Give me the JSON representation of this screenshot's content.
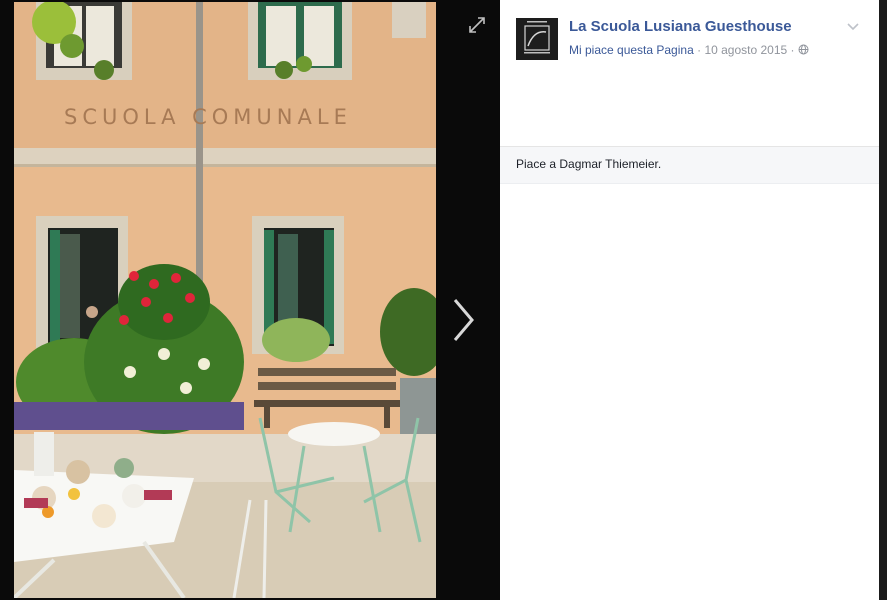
{
  "photo": {
    "sign_text": "SCUOLA COMUNALE",
    "expand_icon": "expand-icon",
    "next_icon": "chevron-right-icon"
  },
  "post": {
    "page_name": "La Scuola Lusiana Guesthouse",
    "like_page": "Mi piace questa Pagina",
    "date": "10 agosto 2015",
    "separator": "·",
    "privacy_icon": "globe-icon",
    "options_icon": "chevron-down-icon",
    "avatar_icon": "logo-icon"
  },
  "likes": {
    "text": "Piace a Dagmar Thiemeier."
  },
  "colors": {
    "link": "#3b5998",
    "meta": "#90949c",
    "wall": "#e7b98d",
    "shutter": "#2f7a55"
  }
}
